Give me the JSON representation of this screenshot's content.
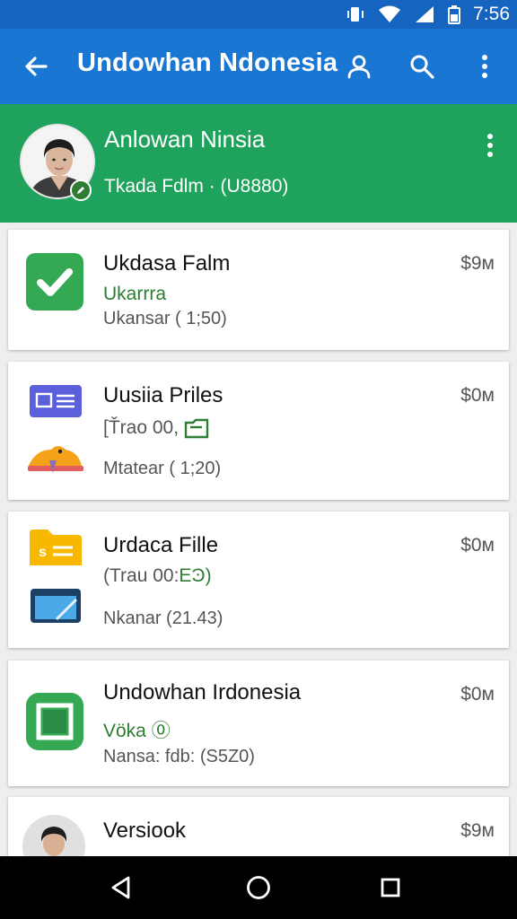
{
  "status_bar": {
    "time": "7:56"
  },
  "app_bar": {
    "title": "Undowhan Ndonesia"
  },
  "profile": {
    "name": "Anlowan Ninsia",
    "subtitle": "Tkada Fdlm · (U8880)"
  },
  "colors": {
    "status_bar": "#1565c0",
    "app_bar": "#1976d2",
    "profile_header": "#1fa35c",
    "accent_green": "#2e7d32"
  },
  "items": [
    {
      "title": "Ukdasa Falm",
      "status": "Ukarrra",
      "meta": "Ukansar ( 1;50)",
      "price": "$9м",
      "icon": "check-icon"
    },
    {
      "title": "Uusiia Priles",
      "status": "[Ťrao 00,",
      "meta": "Mtatear ( 1;20)",
      "price": "$0м",
      "icon": "document-card-icon"
    },
    {
      "title": "Urdaca Fille",
      "status": "(Trau 00:",
      "meta": "Nkanar (21.43)",
      "price": "$0м",
      "icon": "sheet-icon"
    },
    {
      "title": "Undowhan Irdonesia",
      "status": "Vöka ⓪",
      "meta": "Nansa: fdb: (S5Z0)",
      "price": "$0м",
      "icon": "square-app-icon"
    },
    {
      "title": "Versiook",
      "price": "$9м",
      "icon": "avatar"
    }
  ]
}
